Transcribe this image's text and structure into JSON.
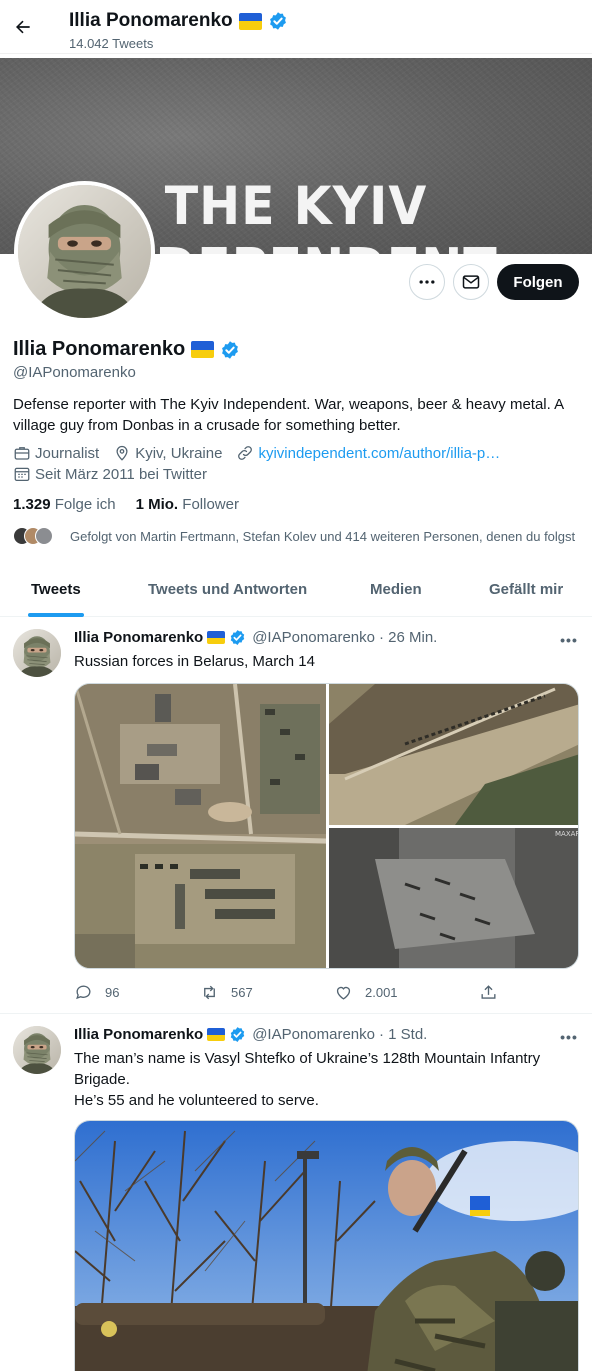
{
  "header": {
    "name": "Illia Ponomarenko",
    "tweet_count": "14.042 Tweets"
  },
  "banner": {
    "text": "THE KYIV INDEPENDENT"
  },
  "profile": {
    "name": "Illia Ponomarenko",
    "handle": "@IAPonomarenko",
    "bio": "Defense reporter with The Kyiv Independent. War, weapons, beer & heavy metal. A village guy from Donbas in a crusade for something better.",
    "job": "Journalist",
    "location": "Kyiv, Ukraine",
    "website": "kyivindependent.com/author/illia-p…",
    "joined": "Seit März 2011 bei Twitter",
    "following_count": "1.329",
    "following_label": "Folge ich",
    "followers_count": "1 Mio.",
    "followers_label": "Follower",
    "followed_by": "Gefolgt von Martin Fertmann, Stefan Kolev und 414 weiteren Personen, denen du folgst"
  },
  "actions": {
    "follow_label": "Folgen"
  },
  "tabs": [
    {
      "label": "Tweets"
    },
    {
      "label": "Tweets und Antworten"
    },
    {
      "label": "Medien"
    },
    {
      "label": "Gefällt mir"
    }
  ],
  "tweets": [
    {
      "name": "Illia Ponomarenko",
      "handle": "@IAPonomarenko",
      "time": "· 26 Min.",
      "text": "Russian forces in Belarus, March 14",
      "replies": "96",
      "retweets": "567",
      "likes": "2.001",
      "watermark": "MAXAR"
    },
    {
      "name": "Illia Ponomarenko",
      "handle": "@IAPonomarenko",
      "time": "· 1 Std.",
      "text_line1": "The man’s name is Vasyl Shtefko of Ukraine’s 128th Mountain Infantry Brigade.",
      "text_line2": "He’s 55 and he volunteered to serve."
    }
  ],
  "colors": {
    "accent": "#1d9bf0",
    "text": "#0f1419",
    "muted": "#536471",
    "flag_blue": "#1f5fd6",
    "flag_yellow": "#f7cd0d"
  },
  "icons": [
    "back-arrow-icon",
    "verified-badge-icon",
    "more-icon",
    "mail-icon",
    "briefcase-icon",
    "location-icon",
    "link-icon",
    "calendar-icon",
    "reply-icon",
    "retweet-icon",
    "like-icon",
    "share-icon"
  ]
}
